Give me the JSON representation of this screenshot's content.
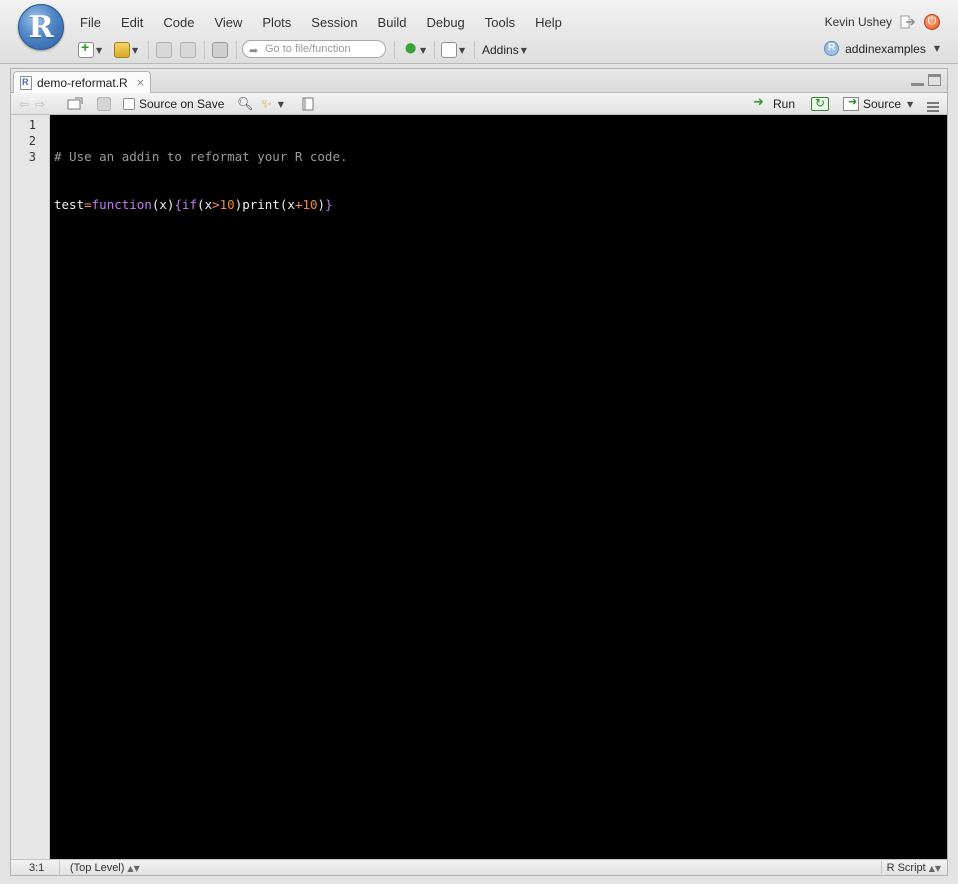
{
  "app": {
    "logo_letter": "R",
    "menu": [
      "File",
      "Edit",
      "Code",
      "View",
      "Plots",
      "Session",
      "Build",
      "Debug",
      "Tools",
      "Help"
    ],
    "user_name": "Kevin Ushey"
  },
  "toolbar": {
    "goto_placeholder": "Go to file/function",
    "addins_label": "Addins",
    "project_name": "addinexamples"
  },
  "editor": {
    "tab_label": "demo-reformat.R",
    "tab_close": "×",
    "source_on_save_label": "Source on Save",
    "source_on_save_checked": false,
    "run_label": "Run",
    "source_label": "Source",
    "line_numbers": [
      "1",
      "2",
      "3"
    ],
    "code_lines": [
      "# Use an addin to reformat your R code.",
      "test=function(x){if(x>10)print(x+10)}",
      ""
    ]
  },
  "status": {
    "cursor_position": "3:1",
    "scope": "(Top Level)",
    "language": "R Script"
  },
  "colors": {
    "editor_background": "#000000",
    "comment": "#9a9a9a",
    "keyword": "#c47df2",
    "number": "#f28b3a",
    "operator": "#ff8f5e"
  }
}
